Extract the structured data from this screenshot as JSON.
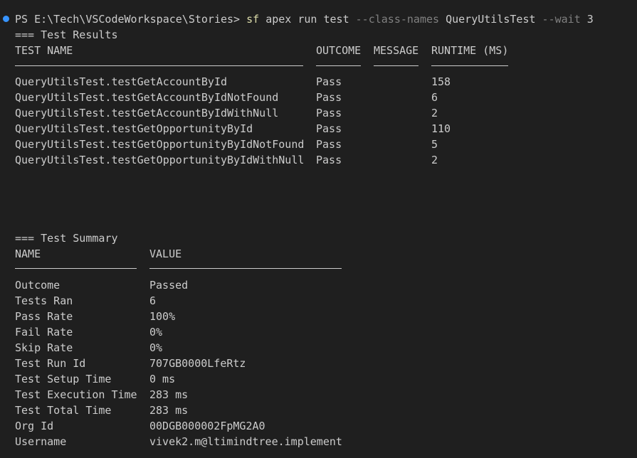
{
  "prompt": {
    "text": "PS E:\\Tech\\VSCodeWorkspace\\Stories>",
    "command": "sf",
    "subcommand": "apex run test",
    "flag_class": "--class-names",
    "class_value": "QueryUtilsTest",
    "flag_wait": "--wait",
    "wait_value": "3"
  },
  "results": {
    "heading": "=== Test Results",
    "headers": {
      "name": "TEST NAME",
      "outcome": "OUTCOME",
      "message": "MESSAGE",
      "runtime": "RUNTIME (MS)"
    },
    "rows": [
      {
        "name": "QueryUtilsTest.testGetAccountById",
        "outcome": "Pass",
        "message": "",
        "runtime": "158"
      },
      {
        "name": "QueryUtilsTest.testGetAccountByIdNotFound",
        "outcome": "Pass",
        "message": "",
        "runtime": "6"
      },
      {
        "name": "QueryUtilsTest.testGetAccountByIdWithNull",
        "outcome": "Pass",
        "message": "",
        "runtime": "2"
      },
      {
        "name": "QueryUtilsTest.testGetOpportunityById",
        "outcome": "Pass",
        "message": "",
        "runtime": "110"
      },
      {
        "name": "QueryUtilsTest.testGetOpportunityByIdNotFound",
        "outcome": "Pass",
        "message": "",
        "runtime": "5"
      },
      {
        "name": "QueryUtilsTest.testGetOpportunityByIdWithNull",
        "outcome": "Pass",
        "message": "",
        "runtime": "2"
      }
    ]
  },
  "summary": {
    "heading": "=== Test Summary",
    "headers": {
      "name": "NAME",
      "value": "VALUE"
    },
    "rows": [
      {
        "name": "Outcome",
        "value": "Passed"
      },
      {
        "name": "Tests Ran",
        "value": "6"
      },
      {
        "name": "Pass Rate",
        "value": "100%"
      },
      {
        "name": "Fail Rate",
        "value": "0%"
      },
      {
        "name": "Skip Rate",
        "value": "0%"
      },
      {
        "name": "Test Run Id",
        "value": "707GB0000LfeRtz"
      },
      {
        "name": "Test Setup Time",
        "value": "0 ms"
      },
      {
        "name": "Test Execution Time",
        "value": "283 ms"
      },
      {
        "name": "Test Total Time",
        "value": "283 ms"
      },
      {
        "name": "Org Id",
        "value": "00DGB000002FpMG2A0"
      },
      {
        "name": "Username",
        "value": "vivek2.m@ltimindtree.implement"
      }
    ]
  },
  "colors": {
    "background": "#1f1f1f",
    "text": "#cccccc",
    "command": "#dcdcaa",
    "flag": "#808080",
    "status_dot": "#3794ff"
  }
}
